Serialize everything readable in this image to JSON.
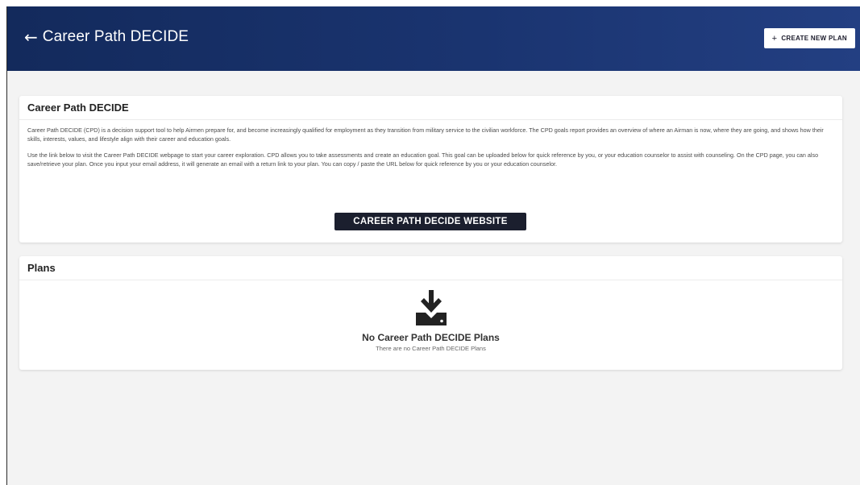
{
  "header": {
    "back_icon": "←",
    "title": "Career Path DECIDE",
    "create_plan": {
      "icon": "+",
      "label": "CREATE NEW PLAN"
    }
  },
  "info_card": {
    "title": "Career Path DECIDE",
    "paragraph_1": "Career Path DECIDE (CPD) is a decision support tool to help Airmen prepare for, and become increasingly qualified for employment as they transition from military service to the civilian workforce. The CPD goals report provides an overview of where an Airman is now, where they are going, and shows how their skills, interests, values, and lifestyle align with their career and education goals.",
    "paragraph_2": "Use the link below to visit the Career Path DECIDE webpage to start your career exploration. CPD allows you to take assessments and create an education goal. This goal can be uploaded below for quick reference by you, or your education counselor to assist with counseling. On the CPD page, you can also save/retrieve your plan. Once you input your email address, it will generate an email with a return link to your plan. You can copy / paste the URL below for quick reference by you or your education counselor.",
    "website_button": "CAREER PATH DECIDE WEBSITE"
  },
  "plans_card": {
    "title": "Plans",
    "empty_icon": "download-tray-icon",
    "empty_title": "No Career Path DECIDE Plans",
    "empty_subtitle": "There are no Career Path DECIDE Plans"
  },
  "colors": {
    "header_start": "#132a5c",
    "header_end": "#233f82",
    "button_dark": "#1b1f2e",
    "background": "#f3f3f3"
  }
}
